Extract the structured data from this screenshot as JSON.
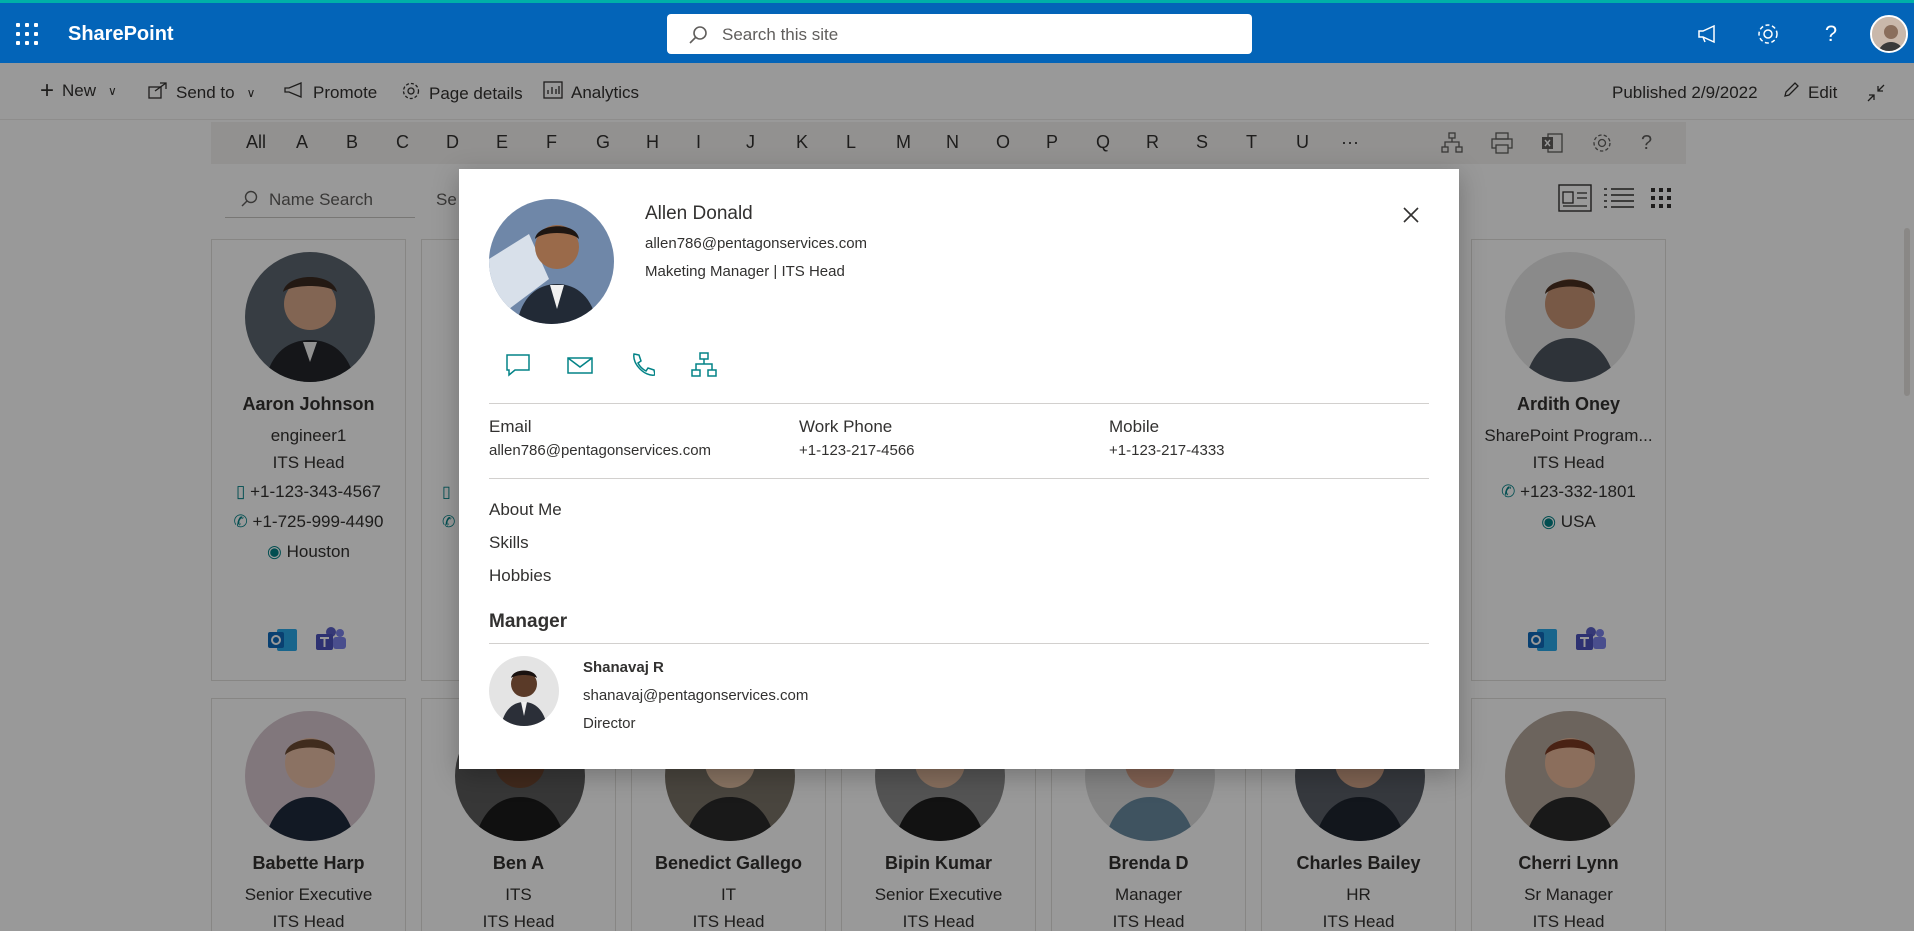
{
  "suite": {
    "title": "SharePoint",
    "search_placeholder": "Search this site"
  },
  "commands": {
    "new": "New",
    "send_to": "Send to",
    "promote": "Promote",
    "page_details": "Page details",
    "analytics": "Analytics",
    "published": "Published 2/9/2022",
    "edit": "Edit"
  },
  "alphabet": [
    "All",
    "A",
    "B",
    "C",
    "D",
    "E",
    "F",
    "G",
    "H",
    "I",
    "J",
    "K",
    "L",
    "M",
    "N",
    "O",
    "P",
    "Q",
    "R",
    "S",
    "T",
    "U",
    "···"
  ],
  "directory": {
    "name_search_placeholder": "Name Search",
    "select_partial": "Se"
  },
  "cards_top": [
    {
      "name": "Aaron Johnson",
      "title": "engineer1",
      "dept": "ITS Head",
      "mobile": "+1-123-343-4567",
      "phone": "+1-725-999-4490",
      "location": "Houston"
    },
    {
      "name": "Ardith Oney",
      "title": "SharePoint Program...",
      "dept": "ITS Head",
      "phone": "+123-332-1801",
      "location": "USA"
    }
  ],
  "cards_bottom": [
    {
      "name": "Babette Harp",
      "title": "Senior Executive",
      "dept": "ITS Head"
    },
    {
      "name": "Ben A",
      "title": "ITS",
      "dept": "ITS Head"
    },
    {
      "name": "Benedict Gallego",
      "title": "IT",
      "dept": "ITS Head"
    },
    {
      "name": "Bipin Kumar",
      "title": "Senior Executive",
      "dept": "ITS Head"
    },
    {
      "name": "Brenda D",
      "title": "Manager",
      "dept": "ITS Head"
    },
    {
      "name": "Charles Bailey",
      "title": "HR",
      "dept": "ITS Head"
    },
    {
      "name": "Cherri Lynn",
      "title": "Sr Manager",
      "dept": "ITS Head"
    }
  ],
  "profile": {
    "name": "Allen Donald",
    "email": "allen786@pentagonservices.com",
    "title": "Maketing Manager | ITS Head",
    "fields": [
      {
        "label": "Email",
        "value": "allen786@pentagonservices.com"
      },
      {
        "label": "Work Phone",
        "value": "+1-123-217-4566"
      },
      {
        "label": "Mobile",
        "value": "+1-123-217-4333"
      }
    ],
    "sections": [
      "About Me",
      "Skills",
      "Hobbies"
    ],
    "manager_heading": "Manager",
    "manager": {
      "name": "Shanavaj R",
      "email": "shanavaj@pentagonservices.com",
      "title": "Director"
    }
  },
  "colors": {
    "suite_bar": "#0364b8",
    "accent_teal": "#038387",
    "outlook_blue": "#0f6cbd",
    "teams_purple": "#5b5fc7"
  }
}
